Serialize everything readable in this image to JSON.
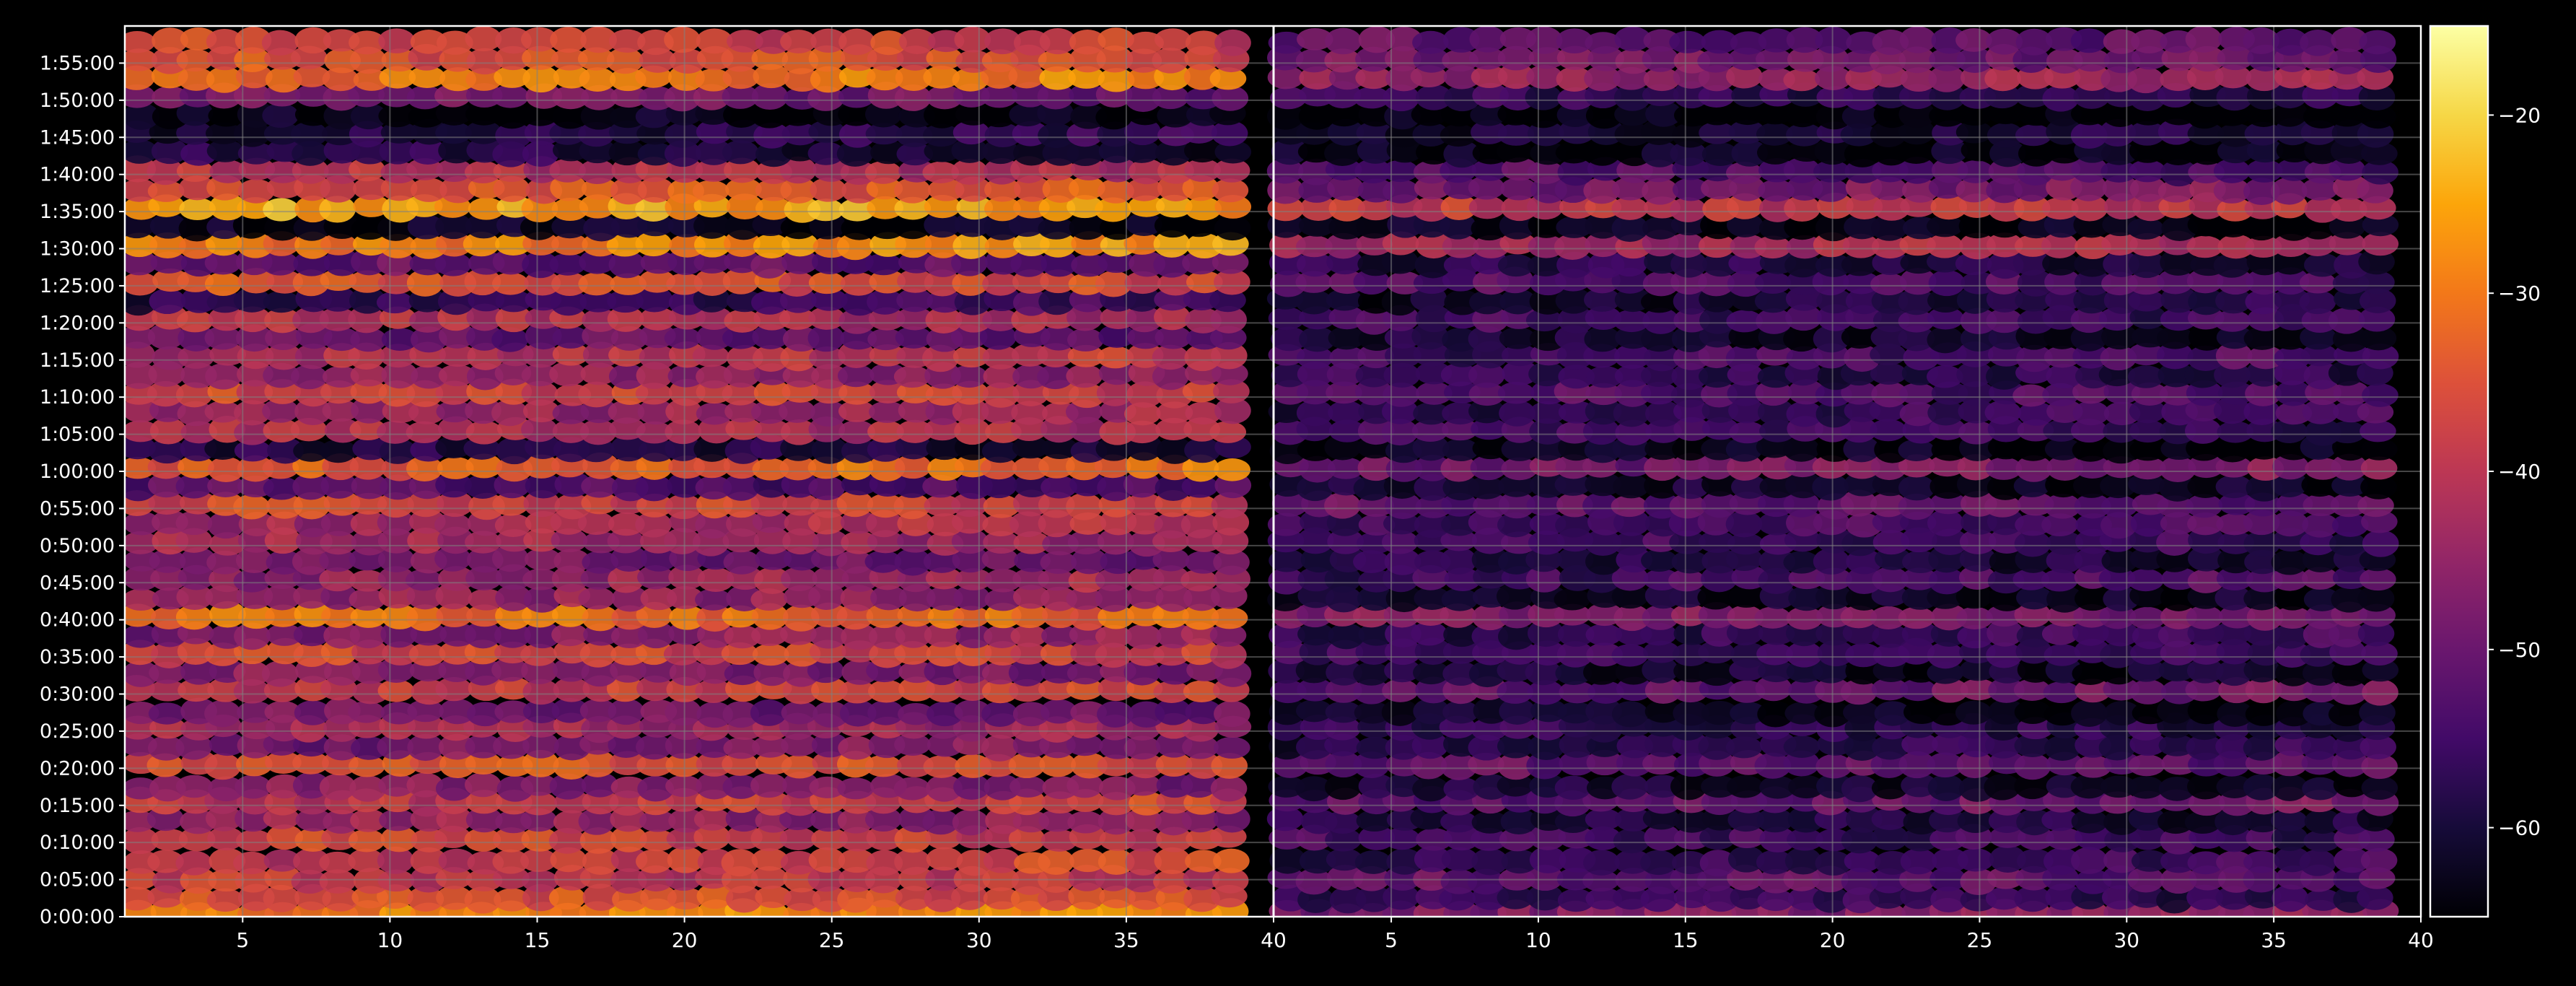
{
  "chart_data": {
    "type": "heatmap",
    "panels": [
      {
        "name": "",
        "x_ticks": [
          5,
          10,
          15,
          20,
          25,
          30,
          35,
          40
        ],
        "xlim": [
          1,
          40
        ],
        "channels": 39
      },
      {
        "name": "",
        "x_ticks": [
          5,
          10,
          15,
          20,
          25,
          30,
          35,
          40
        ],
        "xlim": [
          1,
          40
        ],
        "channels": 39
      }
    ],
    "y_ticks": [
      "0:00:00",
      "0:05:00",
      "0:10:00",
      "0:15:00",
      "0:20:00",
      "0:25:00",
      "0:30:00",
      "0:35:00",
      "0:40:00",
      "0:45:00",
      "0:50:00",
      "0:55:00",
      "1:00:00",
      "1:05:00",
      "1:10:00",
      "1:15:00",
      "1:20:00",
      "1:25:00",
      "1:30:00",
      "1:35:00",
      "1:40:00",
      "1:45:00",
      "1:50:00",
      "1:55:00"
    ],
    "ylim_minutes": [
      0,
      120
    ],
    "row_minutes": [
      0.5,
      2.5,
      5,
      7.5,
      10.5,
      13,
      15.5,
      17.5,
      20.5,
      23,
      25.5,
      27.5,
      30.5,
      33,
      35.5,
      38,
      40.5,
      43,
      45.5,
      48,
      50.5,
      53,
      55.5,
      58,
      60.5,
      63,
      65.5,
      68,
      70.5,
      73,
      75.5,
      78,
      80.5,
      83,
      85.5,
      88,
      90.5,
      93,
      95.5,
      98,
      100.5,
      103,
      105.5,
      108,
      110.5,
      113,
      115.5,
      118
    ],
    "row_levels_panel_1": [
      -30,
      -34,
      -38,
      -40,
      -36,
      -44,
      -40,
      -46,
      -34,
      -50,
      -42,
      -48,
      -40,
      -46,
      -36,
      -48,
      -30,
      -44,
      -46,
      -48,
      -42,
      -44,
      -36,
      -52,
      -34,
      -58,
      -40,
      -46,
      -36,
      -44,
      -42,
      -50,
      -40,
      -58,
      -34,
      -50,
      -30,
      -62,
      -24,
      -36,
      -40,
      -58,
      -60,
      -62,
      -48,
      -32,
      -34,
      -36
    ],
    "row_levels_panel_2": [
      -48,
      -56,
      -50,
      -58,
      -54,
      -58,
      -52,
      -60,
      -50,
      -60,
      -56,
      -62,
      -52,
      -60,
      -54,
      -58,
      -46,
      -60,
      -56,
      -58,
      -54,
      -56,
      -50,
      -60,
      -50,
      -62,
      -54,
      -58,
      -52,
      -56,
      -56,
      -60,
      -54,
      -62,
      -52,
      -58,
      -44,
      -62,
      -38,
      -50,
      -52,
      -62,
      -62,
      -64,
      -56,
      -46,
      -48,
      -50
    ],
    "colorbar": {
      "colormap": "inferno",
      "range": [
        -65,
        -15
      ],
      "ticks": [
        -20,
        -30,
        -40,
        -50,
        -60
      ]
    },
    "grid": true,
    "colors": {
      "background": "#000000",
      "axis": "#ffffff",
      "grid": "#808080"
    }
  }
}
